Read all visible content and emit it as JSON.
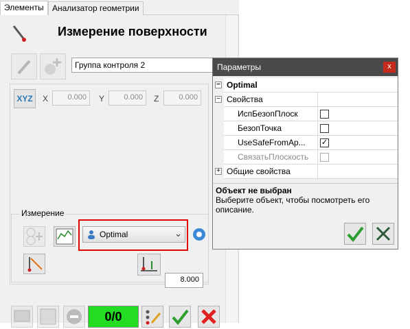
{
  "tabs": [
    "Элементы",
    "Анализатор геометрии"
  ],
  "panel": {
    "title": "Измерение поверхности",
    "group_name": "Группа контроля 2",
    "xyz_label": "XYZ",
    "coords": [
      {
        "axis": "X",
        "value": "0.000"
      },
      {
        "axis": "Y",
        "value": "0.000"
      },
      {
        "axis": "Z",
        "value": "0.000"
      }
    ],
    "measure_label": "Измерение",
    "combo_value": "Optimal",
    "offset_value": "8.000",
    "counter": "0/0"
  },
  "dialog": {
    "title": "Параметры",
    "close": "x",
    "section": "Optimal",
    "group_props": "Свойства",
    "props": [
      {
        "name": "ИспБезопПлоск",
        "checked": false,
        "disabled": false
      },
      {
        "name": "БезопТочка",
        "checked": false,
        "disabled": false
      },
      {
        "name": "UseSafeFromAp...",
        "checked": true,
        "disabled": false
      },
      {
        "name": "СвязатьПлоскость",
        "checked": false,
        "disabled": true
      }
    ],
    "general": "Общие свойства",
    "help_title": "Объект не выбран",
    "help_text": "Выберите объект, чтобы посмотреть его описание."
  },
  "colors": {
    "counter_bg": "#22dd22",
    "highlight": "#e00000",
    "ok": "#2e9d2e",
    "cancel": "#e02020"
  }
}
